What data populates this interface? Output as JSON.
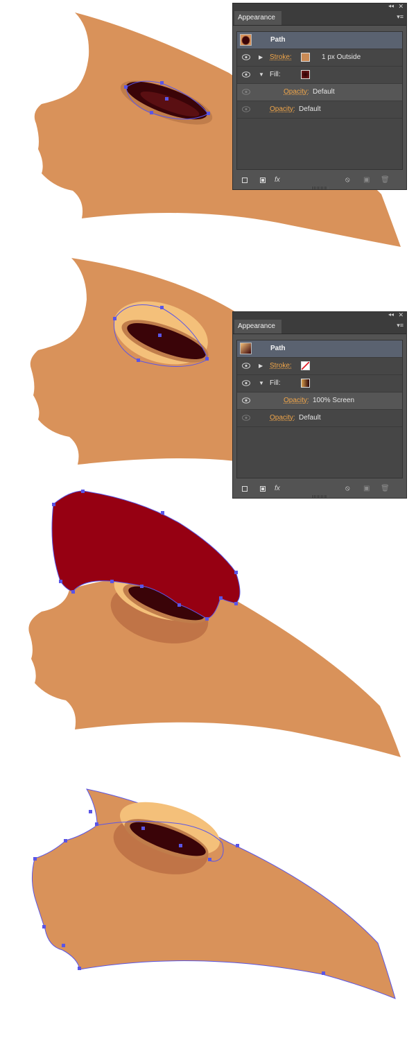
{
  "panels": [
    {
      "collapse_glyph": "◂◂",
      "close_glyph": "✕",
      "tab_label": "Appearance",
      "menu_glyph": "▾≡",
      "title": "Path",
      "thumb_icon": "path-thumbnail-icon",
      "stroke": {
        "label": "Stroke:",
        "value": "1 px  Outside",
        "swatch_color": "#c98a55"
      },
      "fill": {
        "label": "Fill:",
        "swatch_color": "#4a0a10"
      },
      "fill_opacity": {
        "label": "Opacity:",
        "value": "Default"
      },
      "opacity": {
        "label": "Opacity:",
        "value": "Default"
      }
    },
    {
      "collapse_glyph": "◂◂",
      "close_glyph": "✕",
      "tab_label": "Appearance",
      "menu_glyph": "▾≡",
      "title": "Path",
      "thumb_icon": "path-thumbnail-icon",
      "stroke": {
        "label": "Stroke:",
        "value": "",
        "swatch_color": "none"
      },
      "fill": {
        "label": "Fill:",
        "swatch_color": "#d9a04f"
      },
      "fill_opacity": {
        "label": "Opacity:",
        "value": "100% Screen"
      },
      "opacity": {
        "label": "Opacity:",
        "value": "Default"
      }
    }
  ],
  "colors": {
    "beak": "#d9925a",
    "nostril_dark": "#3a0408",
    "highlight": "#f4c07a",
    "red_cap": "#960012",
    "anchor": "#5a55e6"
  },
  "footer_icons": [
    "new-layer-icon",
    "fill-layer-icon",
    "fx-icon",
    "clear-icon",
    "duplicate-icon",
    "delete-icon"
  ],
  "fx_label": "fx"
}
